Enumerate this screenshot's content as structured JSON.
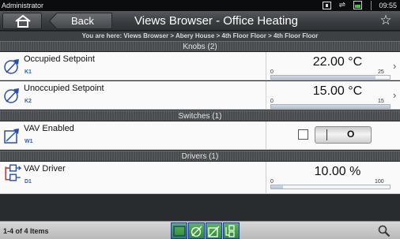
{
  "statusbar": {
    "user": "Administrator",
    "time": "09:55"
  },
  "titlebar": {
    "back_label": "Back",
    "title": "Views Browser - Office Heating",
    "fav_icon": "star-icon"
  },
  "breadcrumb": "You are here: Views Browser > Abery House > 4th Floor Floor > 4th Floor Floor",
  "sections": {
    "knobs": "Knobs (2)",
    "switches": "Switches (1)",
    "drivers": "Drivers (1)"
  },
  "knobs": [
    {
      "name": "Occupied Setpoint",
      "code": "K1",
      "value": "22.00 °C",
      "min": "0",
      "max": "25",
      "fraction": 0.88
    },
    {
      "name": "Unoccupied Setpoint",
      "code": "K2",
      "value": "15.00 °C",
      "min": "0",
      "max": "15",
      "fraction": 1.0
    }
  ],
  "switches": [
    {
      "name": "VAV Enabled",
      "code": "W1",
      "on_label": "|",
      "off_label": "O",
      "checked": false
    }
  ],
  "drivers": [
    {
      "name": "VAV Driver",
      "code": "D1",
      "value": "10.00 %",
      "min": "0",
      "max": "100",
      "fraction": 0.1
    }
  ],
  "footer": {
    "count": "1-4 of 4 Items"
  },
  "colors": {
    "accent": "#2f5fb0",
    "tab_green": "#2e8a2e",
    "icon_blue": "#2a4fa8",
    "driver_red": "#c0392b"
  }
}
